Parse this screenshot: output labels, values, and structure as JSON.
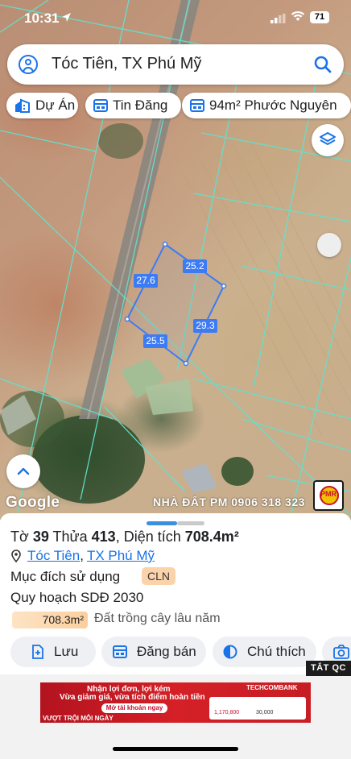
{
  "status_bar": {
    "time": "10:31",
    "battery": "71"
  },
  "search": {
    "query": "Tóc Tiên, TX Phú Mỹ"
  },
  "chips": [
    {
      "label": "Dự Án",
      "icon": "building-icon"
    },
    {
      "label": "Tin Đăng",
      "icon": "listing-icon"
    },
    {
      "label": "94m² Phước Nguyên",
      "icon": "listing-icon"
    }
  ],
  "map": {
    "provider": "Google",
    "watermark": "NHÀ ĐẤT PM 0906 318 323",
    "brand_logo_text": "PMR",
    "parcel_edges": {
      "north": "25.2",
      "west": "27.6",
      "east": "29.3",
      "south": "25.5"
    },
    "colors": {
      "parcel": "#3d7bf5",
      "grid": "#63e0cf"
    }
  },
  "parcel": {
    "to_label": "Tờ",
    "to_number": "39",
    "thua_label": "Thửa",
    "thua_number": "413",
    "area_label": "Diện tích",
    "area_value": "708.4m²",
    "location_commune": "Tóc Tiên",
    "location_town": "TX Phú Mỹ",
    "purpose_label": "Mục đích sử dụng",
    "purpose_code": "CLN",
    "plan_label": "Quy hoạch SDĐ 2030",
    "plan_area": "708.3m²",
    "plan_desc": "Đất trồng cây lâu năm"
  },
  "actions": {
    "save": "Lưu",
    "post": "Đăng bán",
    "legend": "Chú thích"
  },
  "ad": {
    "close_label": "TẮT QC",
    "headline": "Nhận lợi đơn, lợi kém",
    "subline": "Vừa giảm giá, vừa tích điểm hoàn tiền",
    "cta": "Mở tài khoản ngay",
    "tagline": "VƯỢT TRỘI MỖI NGÀY",
    "bank": "TECHCOMBANK",
    "price1": "1,170,800",
    "price2": "30,000"
  }
}
